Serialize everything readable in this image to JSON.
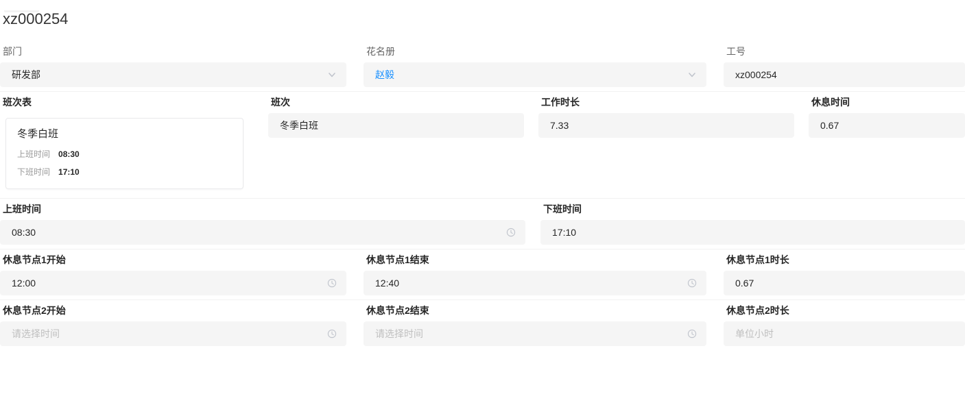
{
  "page": {
    "title": "xz000254"
  },
  "colors": {
    "accent_blue": "#1890ff",
    "field_background": "#f5f5f5",
    "row_divider": "#f2f2f2",
    "label_dark": "#262626",
    "label_gray": "#666666",
    "placeholder_gray": "#bfbfbf",
    "icon_gray": "#c0c4cc"
  },
  "icons": {
    "chevron_down": "chevron-down-icon (∨ outline)",
    "clock": "clock-icon (circle with hands)"
  },
  "form": {
    "department": {
      "label": "部门",
      "value": "研发部"
    },
    "roster": {
      "label": "花名册",
      "value": "赵毅"
    },
    "employee_id": {
      "label": "工号",
      "value": "xz000254"
    },
    "shift_table": {
      "label": "班次表",
      "card": {
        "title": "冬季白班",
        "start_label": "上班时间",
        "start_value": "08:30",
        "end_label": "下班时间",
        "end_value": "17:10"
      }
    },
    "shift": {
      "label": "班次",
      "value": "冬季白班"
    },
    "work_hours": {
      "label": "工作时长",
      "value": "7.33"
    },
    "rest_hours": {
      "label": "休息时间",
      "value": "0.67"
    },
    "start_time": {
      "label": "上班时间",
      "value": "08:30"
    },
    "end_time": {
      "label": "下班时间",
      "value": "17:10"
    },
    "rest1_start": {
      "label": "休息节点1开始",
      "value": "12:00"
    },
    "rest1_end": {
      "label": "休息节点1结束",
      "value": "12:40"
    },
    "rest1_duration": {
      "label": "休息节点1时长",
      "value": "0.67"
    },
    "rest2_start": {
      "label": "休息节点2开始",
      "placeholder": "请选择时间"
    },
    "rest2_end": {
      "label": "休息节点2结束",
      "placeholder": "请选择时间"
    },
    "rest2_duration": {
      "label": "休息节点2时长",
      "placeholder": "单位小时"
    }
  }
}
